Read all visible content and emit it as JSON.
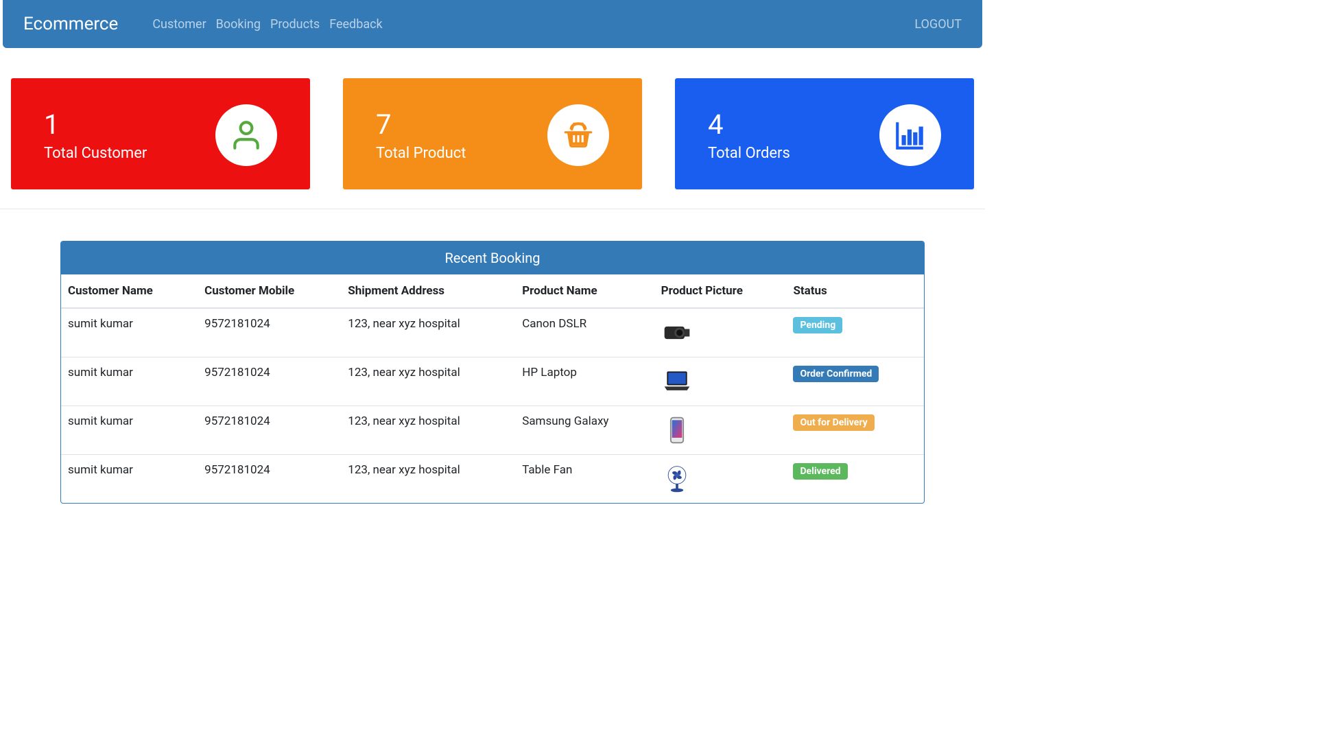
{
  "brand": "Ecommerce",
  "nav": {
    "customer": "Customer",
    "booking": "Booking",
    "products": "Products",
    "feedback": "Feedback",
    "logout": "LOGOUT"
  },
  "cards": {
    "customer": {
      "value": "1",
      "label": "Total Customer"
    },
    "product": {
      "value": "7",
      "label": "Total Product"
    },
    "orders": {
      "value": "4",
      "label": "Total Orders"
    }
  },
  "table": {
    "title": "Recent Booking",
    "headers": {
      "name": "Customer Name",
      "mobile": "Customer Mobile",
      "address": "Shipment Address",
      "product": "Product Name",
      "picture": "Product Picture",
      "status": "Status"
    },
    "rows": [
      {
        "name": "sumit kumar",
        "mobile": "9572181024",
        "address": "123, near xyz hospital",
        "product": "Canon DSLR",
        "status": "Pending",
        "status_class": "pending",
        "icon": "camera"
      },
      {
        "name": "sumit kumar",
        "mobile": "9572181024",
        "address": "123, near xyz hospital",
        "product": "HP Laptop",
        "status": "Order Confirmed",
        "status_class": "confirmed",
        "icon": "laptop"
      },
      {
        "name": "sumit kumar",
        "mobile": "9572181024",
        "address": "123, near xyz hospital",
        "product": "Samsung Galaxy",
        "status": "Out for Delivery",
        "status_class": "out",
        "icon": "phone"
      },
      {
        "name": "sumit kumar",
        "mobile": "9572181024",
        "address": "123, near xyz hospital",
        "product": "Table Fan",
        "status": "Delivered",
        "status_class": "delivered",
        "icon": "fan"
      }
    ]
  }
}
